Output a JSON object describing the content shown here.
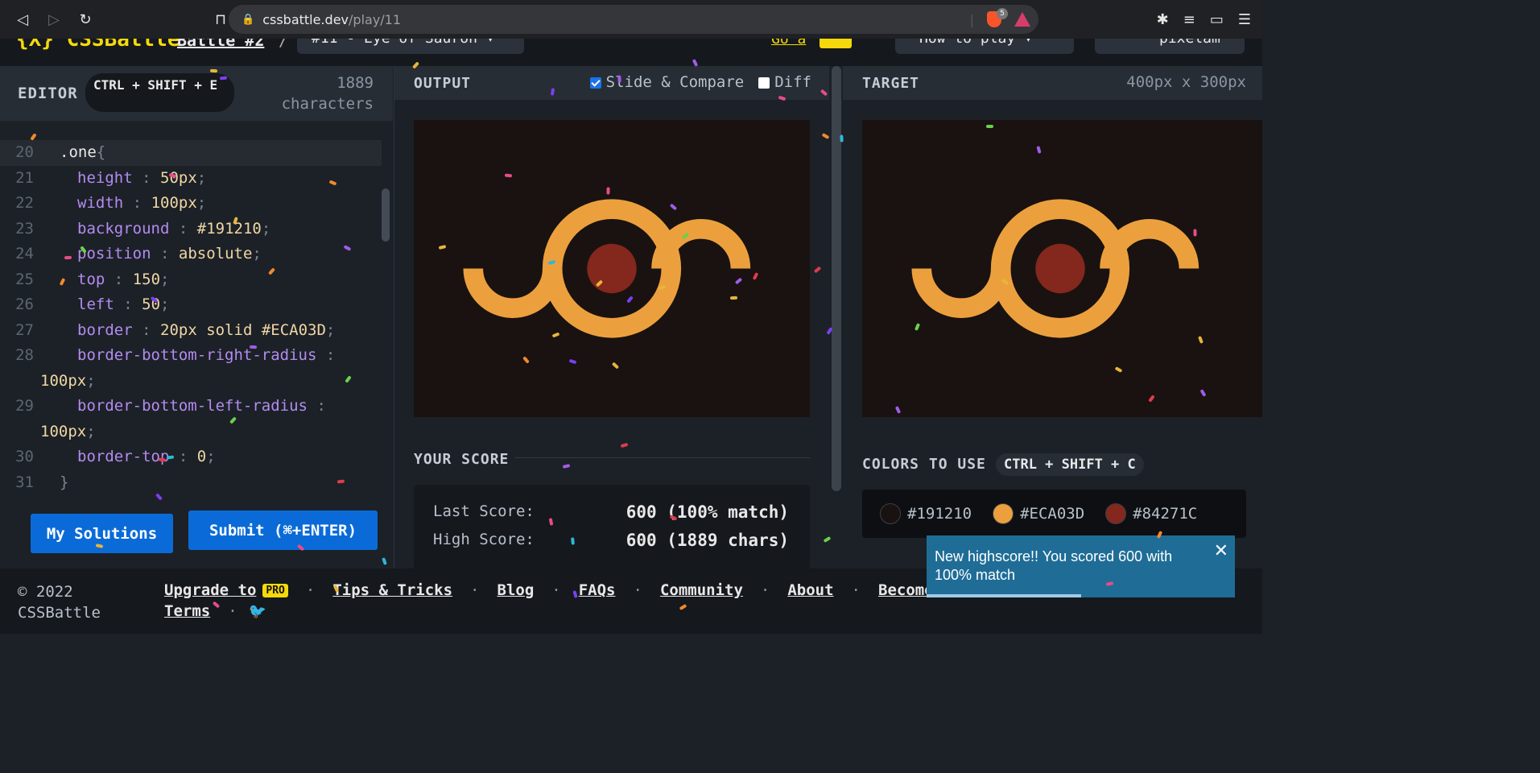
{
  "browser": {
    "url_host": "cssbattle.dev",
    "url_path": "/play/11",
    "brave_count": "5"
  },
  "editor": {
    "title": "EDITOR",
    "shortcut": "CTRL + SHIFT + E",
    "char_count_num": "1889",
    "char_count_label": "characters",
    "lines": [
      {
        "n": "20",
        "html": "<span class='sel'>.one</span><span class='punct'>{</span>",
        "active": true,
        "indent": 0
      },
      {
        "n": "21",
        "html": "<span class='prop'>height</span> <span class='punct'>:</span> <span class='val'>50px</span><span class='punct'>;</span>"
      },
      {
        "n": "22",
        "html": "<span class='prop'>width</span> <span class='punct'>:</span> <span class='val'>100px</span><span class='punct'>;</span>"
      },
      {
        "n": "23",
        "html": "<span class='prop'>background</span> <span class='punct'>:</span> <span class='val'>#191210</span><span class='punct'>;</span>"
      },
      {
        "n": "24",
        "html": "<span class='prop'>position</span> <span class='punct'>:</span> <span class='val'>absolute</span><span class='punct'>;</span>"
      },
      {
        "n": "25",
        "html": "<span class='prop'>top</span> <span class='punct'>:</span> <span class='val'>150</span><span class='punct'>;</span>"
      },
      {
        "n": "26",
        "html": "<span class='prop'>left</span> <span class='punct'>:</span> <span class='val'>50</span><span class='punct'>;</span>"
      },
      {
        "n": "27",
        "html": "<span class='prop'>border</span> <span class='punct'>:</span> <span class='val'>20px solid #ECA03D</span><span class='punct'>;</span>"
      },
      {
        "n": "28",
        "html": "<span class='prop'>border-bottom-right-radius</span> <span class='punct'>:</span>",
        "cont": "<span class='val'>100px</span><span class='punct'>;</span>"
      },
      {
        "n": "29",
        "html": "<span class='prop'>border-bottom-left-radius</span> <span class='punct'>:</span>",
        "cont": "<span class='val'>100px</span><span class='punct'>;</span>"
      },
      {
        "n": "30",
        "html": "<span class='prop'>border-top</span> <span class='punct'>:</span> <span class='val'>0</span><span class='punct'>;</span>"
      },
      {
        "n": "31",
        "html": "<span class='punct'>}</span>",
        "close": true
      }
    ],
    "my_solutions_label": "My Solutions",
    "submit_label": "Submit (⌘+ENTER)"
  },
  "output": {
    "title": "OUTPUT",
    "slide_compare_label": "Slide & Compare",
    "slide_compare_checked": true,
    "diff_label": "Diff",
    "diff_checked": false,
    "score_title": "YOUR SCORE",
    "last_score_label": "Last Score:",
    "last_score_value": "600 (100% match)",
    "high_score_label": "High Score:",
    "high_score_value": "600 (1889 chars)"
  },
  "target": {
    "title": "TARGET",
    "size": "400px x 300px",
    "colors_title": "COLORS TO USE",
    "colors_shortcut": "CTRL + SHIFT + C",
    "colors": [
      {
        "hex": "#191210"
      },
      {
        "hex": "#ECA03D"
      },
      {
        "hex": "#84271C"
      }
    ]
  },
  "footer": {
    "copyright_line1": "© 2022",
    "copyright_line2": "CSSBattle",
    "links": [
      "Upgrade to",
      "Tips & Tricks",
      "Blog",
      "FAQs",
      "Community",
      "About",
      "Become"
    ],
    "pro_badge": "PRO",
    "terms": "Terms"
  },
  "toast": {
    "message": "New highscore!! You scored 600 with 100% match",
    "progress": 0.5
  }
}
